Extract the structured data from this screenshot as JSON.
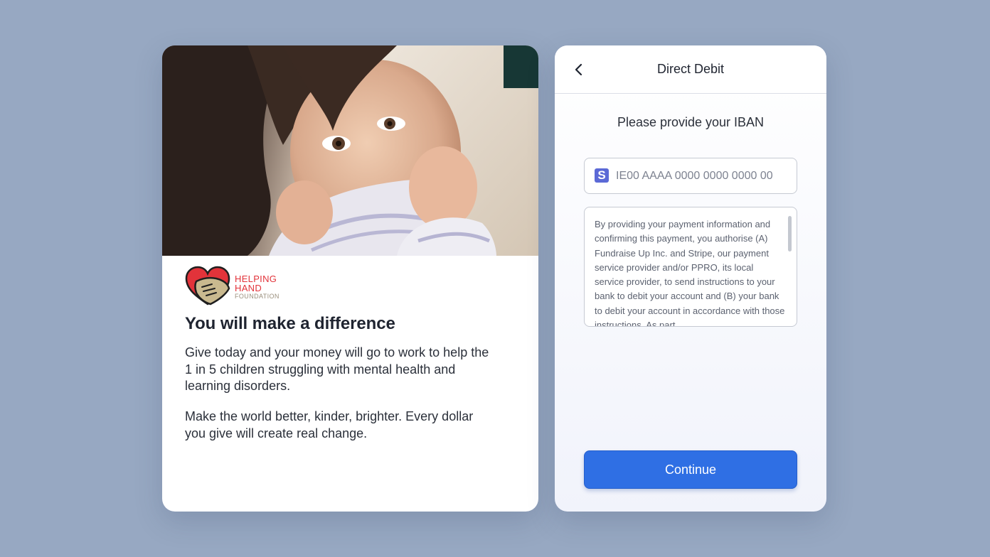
{
  "campaign": {
    "headline": "You will make a difference",
    "paragraphs": [
      "Give today and your money will go to work to help the 1 in 5 children struggling with mental health and learning disorders.",
      "Make the world better, kinder, brighter. Every dollar you give will create real change."
    ],
    "org": {
      "name_line1": "HELPING",
      "name_line2": "HAND",
      "name_line3": "FOUNDATION"
    }
  },
  "checkout": {
    "title": "Direct Debit",
    "back_icon": "chevron-left-icon",
    "prompt": "Please provide your IBAN",
    "iban": {
      "icon": "stripe-s-icon",
      "icon_glyph": "S",
      "value": "",
      "placeholder": "IE00 AAAA 0000 0000 0000 00"
    },
    "mandate_text": "By providing your payment information and confirming this payment, you authorise (A) Fundraise Up Inc. and Stripe, our payment service provider and/or PPRO, its local service provider, to send instructions to your bank to debit your account and (B) your bank to debit your account in accordance with those instructions. As part",
    "continue_label": "Continue"
  },
  "colors": {
    "page_background": "#97a8c2",
    "accent_button": "#2f6fe4",
    "logo_heart": "#e2333a",
    "logo_hand": "#c9b98f",
    "stripe_icon": "#5b69d6"
  }
}
